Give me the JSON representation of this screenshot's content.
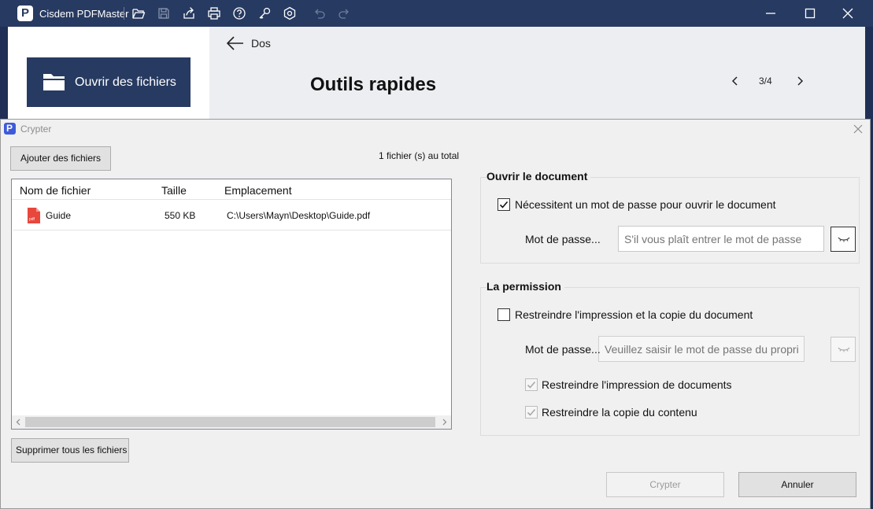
{
  "app": {
    "name": "Cisdem PDFMaster",
    "logo_letter": "P"
  },
  "toolbar_icons": [
    "folder-open-icon",
    "save-icon",
    "share-icon",
    "print-icon",
    "help-icon",
    "key-icon",
    "settings-icon",
    "undo-icon",
    "redo-icon"
  ],
  "window_controls": [
    "minimize-icon",
    "maximize-icon",
    "close-icon"
  ],
  "sidebar": {
    "open_files_label": "Ouvrir des fichiers"
  },
  "main": {
    "back_label": "Dos",
    "title": "Outils rapides",
    "pager": "3/4"
  },
  "dialog": {
    "title": "Crypter",
    "logo_letter": "P",
    "add_files_label": "Ajouter des fichiers",
    "file_count": "1 fichier (s) au total",
    "table": {
      "columns": [
        "Nom de fichier",
        "Taille",
        "Emplacement"
      ],
      "rows": [
        {
          "name": "Guide",
          "size": "550 KB",
          "location": "C:\\Users\\Mayn\\Desktop\\Guide.pdf"
        }
      ]
    },
    "delete_all_label": "Supprimer tous les fichiers",
    "open_group": {
      "title": "Ouvrir le document",
      "require_password_label": "Nécessitent un mot de passe pour ouvrir le document",
      "require_password_checked": true,
      "password_label": "Mot de passe...",
      "password_value": "",
      "password_placeholder": "S'il vous plaît entrer le mot de passe"
    },
    "permission_group": {
      "title": "La permission",
      "restrict_label": "Restreindre l'impression et la copie du document",
      "restrict_checked": false,
      "password_label": "Mot de passe...",
      "password_value": "",
      "password_placeholder": "Veuillez saisir le mot de passe du propriétaire",
      "restrict_print_label": "Restreindre l'impression de documents",
      "restrict_print_checked": true,
      "restrict_copy_label": "Restreindre la copie du contenu",
      "restrict_copy_checked": true
    },
    "encrypt_label": "Crypter",
    "cancel_label": "Annuler"
  },
  "colors": {
    "titlebar": "#273a61",
    "accent": "#273a61",
    "dialog_bg": "#f0f0f0"
  }
}
